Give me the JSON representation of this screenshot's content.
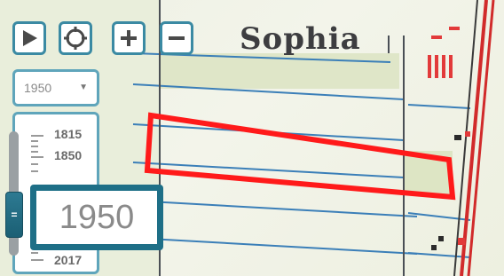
{
  "map": {
    "place_label": "Sophia",
    "highlight_color": "#ff1a1a"
  },
  "controls": {
    "play": {
      "icon": "play-icon"
    },
    "locate": {
      "icon": "crosshair-icon"
    },
    "zoom_in": {
      "icon": "plus-icon"
    },
    "zoom_out": {
      "icon": "minus-icon"
    }
  },
  "year_select": {
    "selected": "1950",
    "caret": "▼"
  },
  "timeline": {
    "ticks": [
      "1815",
      "1850",
      "2017"
    ],
    "handle_glyph": "=",
    "current_year": "1950",
    "accent_color": "#1e6f87"
  }
}
